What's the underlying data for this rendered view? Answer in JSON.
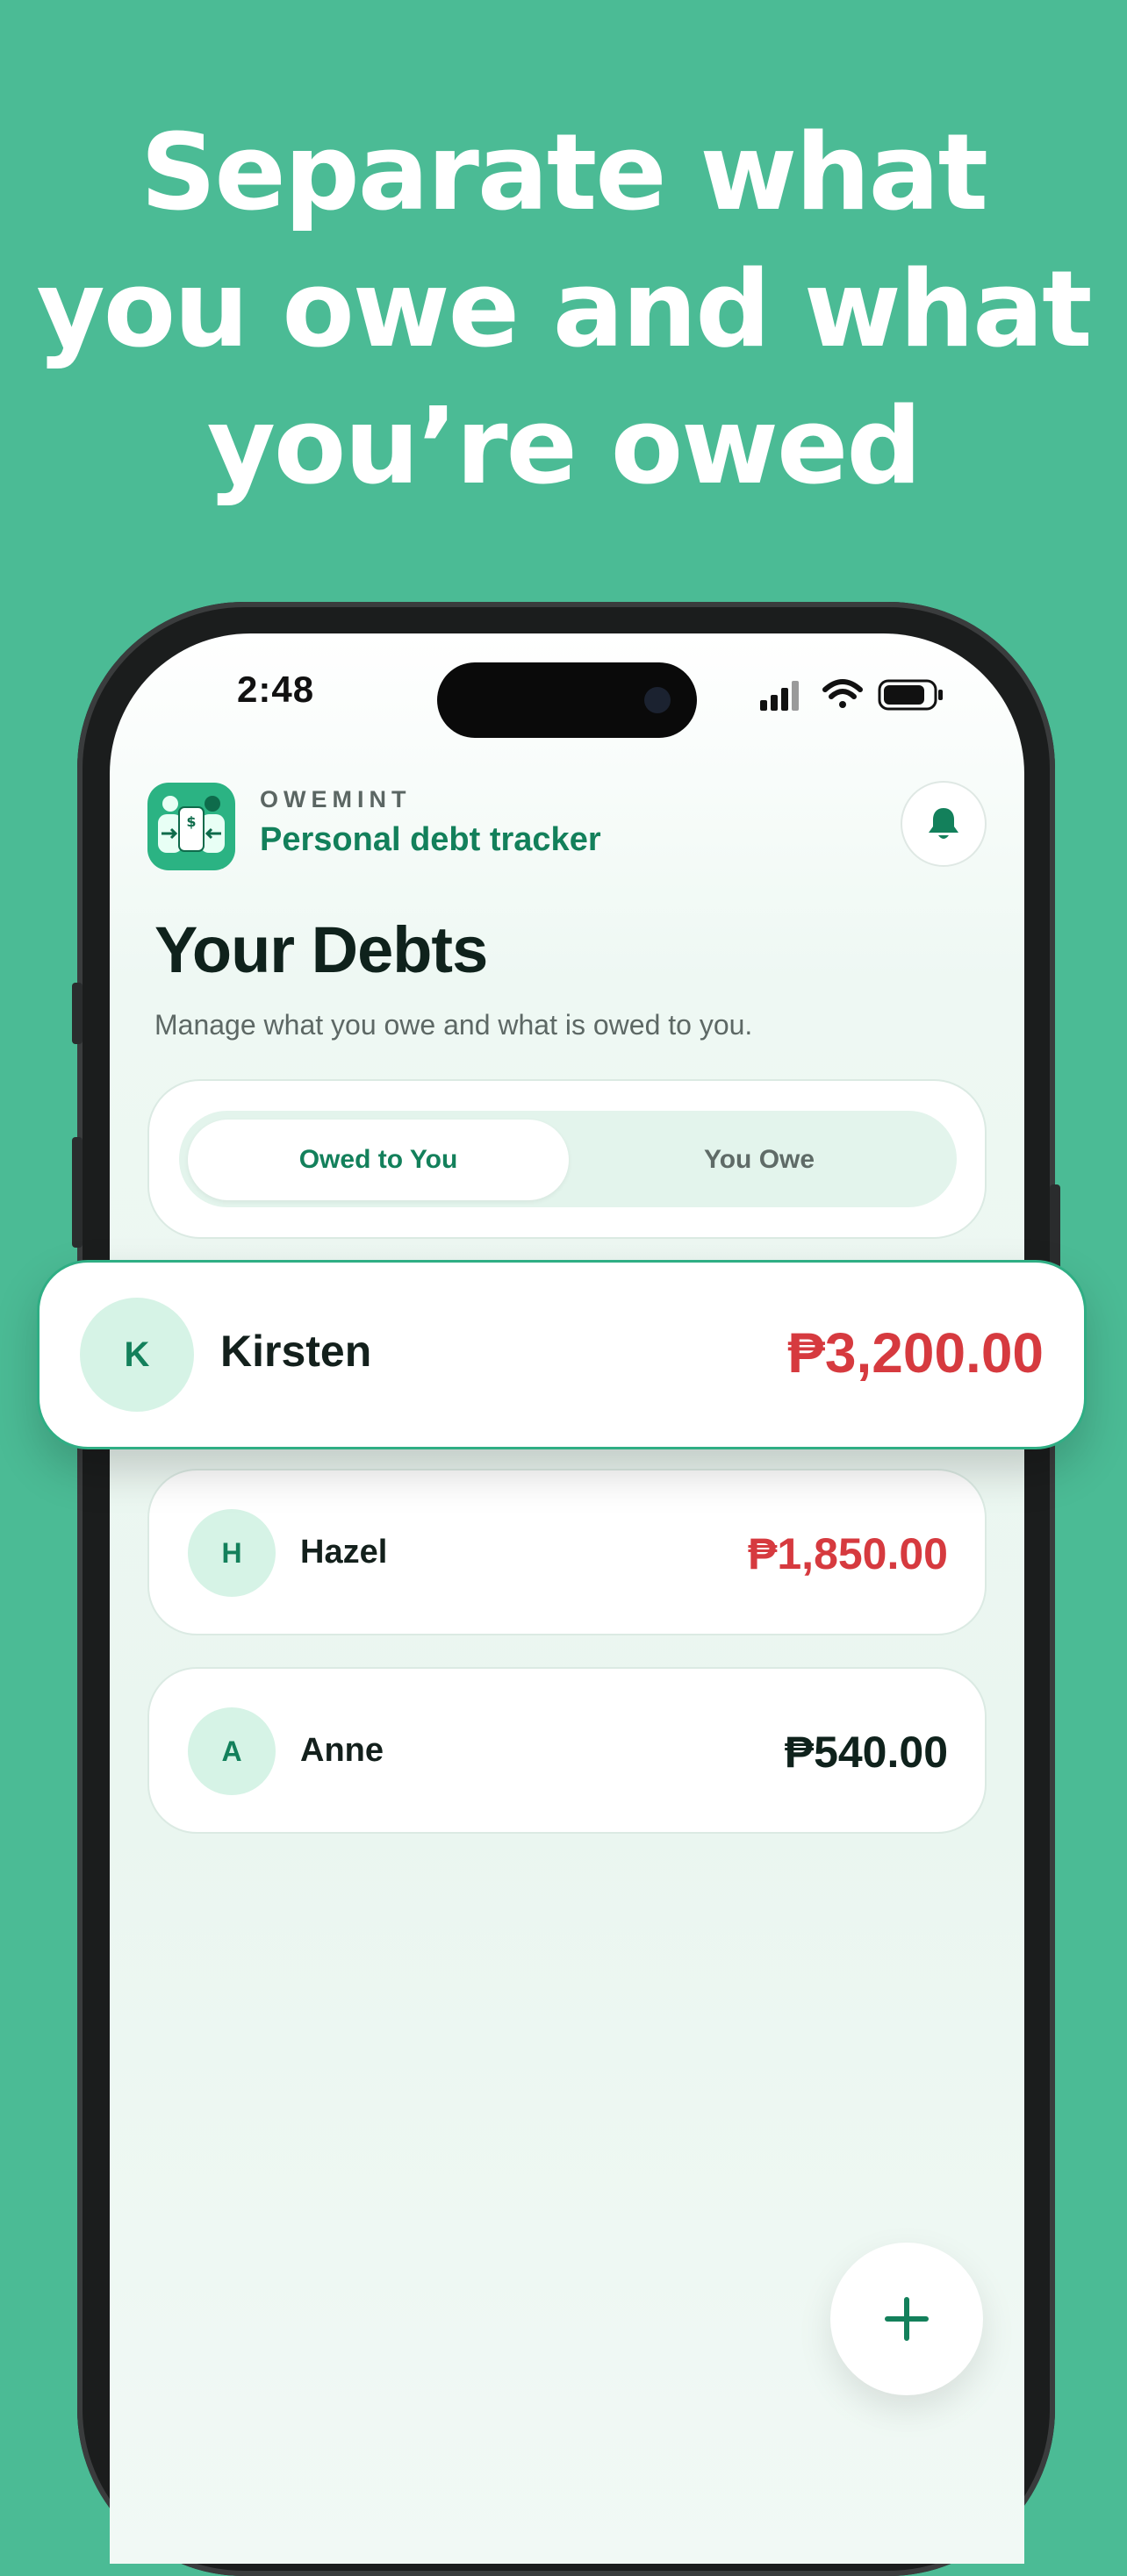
{
  "headline": {
    "line1": "Separate what",
    "line2": "you owe and what",
    "line3": "you’re owed"
  },
  "status_bar": {
    "time": "2:48",
    "icons": [
      "signal-icon",
      "wifi-icon",
      "battery-icon"
    ]
  },
  "app": {
    "brand_small": "OWEMINT",
    "brand_title": "Personal debt tracker",
    "notification_icon": "bell-icon"
  },
  "page": {
    "title": "Your Debts",
    "subtitle": "Manage what you owe and what is owed to you."
  },
  "tabs": [
    {
      "label": "Owed to You",
      "selected": true
    },
    {
      "label": "You Owe",
      "selected": false
    }
  ],
  "debts": [
    {
      "initial": "K",
      "name": "Kirsten",
      "amount": "₱3,200.00",
      "color": "#d63a3f"
    },
    {
      "initial": "H",
      "name": "Hazel",
      "amount": "₱1,850.00",
      "color": "#d63a3f"
    },
    {
      "initial": "A",
      "name": "Anne",
      "amount": "₱540.00",
      "color": "#0f221c"
    }
  ],
  "fab": {
    "icon": "plus-icon"
  },
  "colors": {
    "background": "#4bbb95",
    "brand_green": "#13805b",
    "amount_red": "#d63a3f"
  }
}
